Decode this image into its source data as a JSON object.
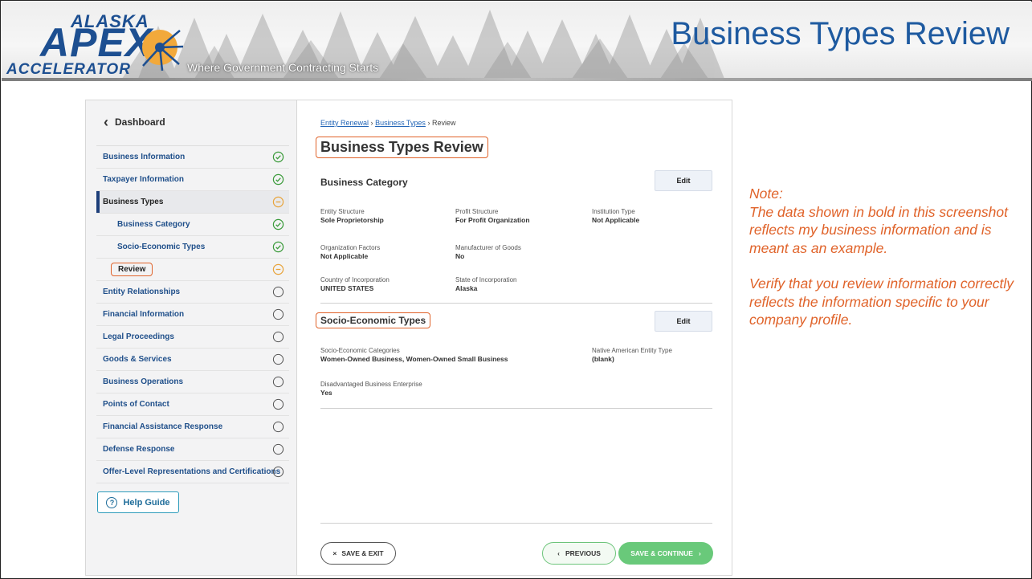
{
  "banner": {
    "logo_top": "ALASKA",
    "logo_main": "APEX",
    "logo_bottom": "ACCELERATOR",
    "tagline": "Where Government Contracting Starts",
    "slide_title": "Business Types Review"
  },
  "sidebar": {
    "dashboard_label": "Dashboard",
    "items": [
      {
        "label": "Business Information",
        "status": "complete"
      },
      {
        "label": "Taxpayer Information",
        "status": "complete"
      },
      {
        "label": "Business Types",
        "status": "in-progress"
      },
      {
        "label": "Business Category",
        "status": "complete"
      },
      {
        "label": "Socio-Economic Types",
        "status": "complete"
      },
      {
        "label": "Review",
        "status": "in-progress"
      },
      {
        "label": "Entity Relationships",
        "status": "not-started"
      },
      {
        "label": "Financial Information",
        "status": "not-started"
      },
      {
        "label": "Legal Proceedings",
        "status": "not-started"
      },
      {
        "label": "Goods & Services",
        "status": "not-started"
      },
      {
        "label": "Business Operations",
        "status": "not-started"
      },
      {
        "label": "Points of Contact",
        "status": "not-started"
      },
      {
        "label": "Financial Assistance Response",
        "status": "not-started"
      },
      {
        "label": "Defense Response",
        "status": "not-started"
      },
      {
        "label": "Offer-Level Representations and Certifications",
        "status": "not-started"
      }
    ],
    "help_label": "Help Guide"
  },
  "main": {
    "breadcrumb": {
      "first": "Entity Renewal",
      "second": "Business Types",
      "current": "Review",
      "separator": "›"
    },
    "title": "Business Types Review",
    "business_category": {
      "title": "Business Category",
      "edit_label": "Edit",
      "fields": {
        "entity_structure": {
          "label": "Entity Structure",
          "value": "Sole Proprietorship"
        },
        "profit_structure": {
          "label": "Profit Structure",
          "value": "For Profit Organization"
        },
        "institution_type": {
          "label": "Institution Type",
          "value": "Not Applicable"
        },
        "organization_factors": {
          "label": "Organization Factors",
          "value": "Not Applicable"
        },
        "manufacturer": {
          "label": "Manufacturer of Goods",
          "value": "No"
        },
        "country": {
          "label": "Country of Incorporation",
          "value": "UNITED STATES"
        },
        "state": {
          "label": "State of Incorporation",
          "value": "Alaska"
        }
      }
    },
    "socio_economic": {
      "title": "Socio-Economic Types",
      "edit_label": "Edit",
      "fields": {
        "categories": {
          "label": "Socio-Economic Categories",
          "value": "Women-Owned Business, Women-Owned Small Business"
        },
        "native_american": {
          "label": "Native American Entity Type",
          "value": "(blank)"
        },
        "disadvantaged": {
          "label": "Disadvantaged Business Enterprise",
          "value": "Yes"
        }
      }
    },
    "buttons": {
      "save_exit": "SAVE & EXIT",
      "previous": "PREVIOUS",
      "save_continue": "SAVE & CONTINUE"
    }
  },
  "note": {
    "heading": "Note:",
    "paragraph1": "The data shown in bold in this screenshot reflects my business information and is meant as an example.",
    "paragraph2": "Verify that you review information correctly reflects the information specific to your company profile."
  },
  "colors": {
    "complete": "#3a9a3a",
    "in_progress": "#e8a43c",
    "not_started": "#555555",
    "highlight": "#e0632a",
    "title_blue": "#1e5aa0"
  }
}
